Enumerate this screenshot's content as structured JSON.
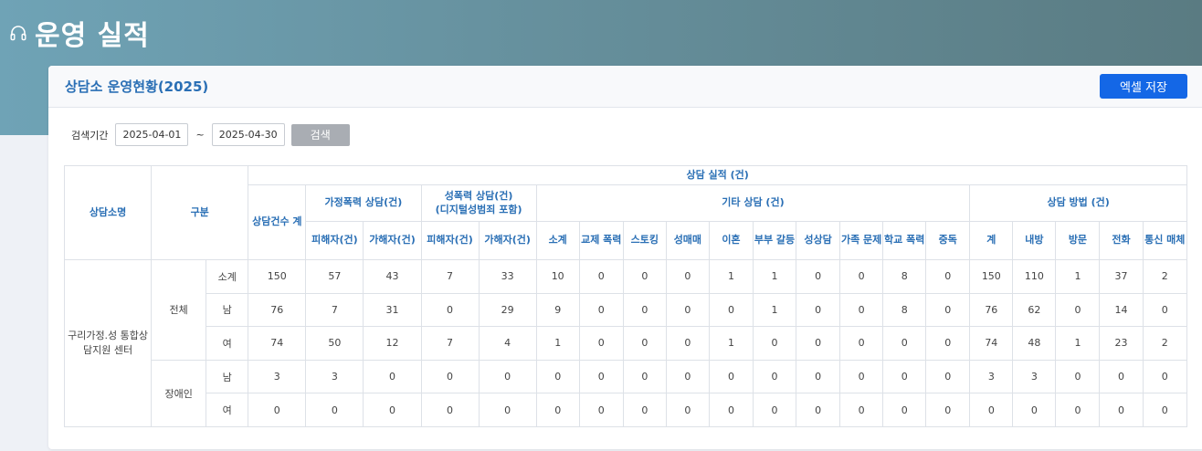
{
  "page": {
    "title": "운영 실적"
  },
  "card": {
    "title": "상담소 운영현황(2025)",
    "excel_button": "엑셀 저장"
  },
  "search": {
    "label": "검색기간",
    "start_date": "2025-04-01",
    "tilde": "~",
    "end_date": "2025-04-30",
    "button": "검색"
  },
  "table": {
    "header": {
      "center": "상담소명",
      "category": "구분",
      "performance": "상담 실적 (건)",
      "total_count": "상담건수 계",
      "domestic": "가정폭력 상담(건)",
      "sexual_line1": "성폭력 상담(건)",
      "sexual_line2": "(디지털성범죄 포함)",
      "other": "기타 상담 (건)",
      "method": "상담 방법 (건)",
      "victim": "피해자(건)",
      "offender": "가해자(건)",
      "subtotal": "소계",
      "dating": "교제 폭력",
      "stalking": "스토킹",
      "prostitution": "성매매",
      "divorce": "이혼",
      "couple": "부부 갈등",
      "sex_counsel": "성상담",
      "family": "가족 문제",
      "school": "학교 폭력",
      "addiction": "중독",
      "m_total": "계",
      "visit_in": "내방",
      "visit_out": "방문",
      "phone": "전화",
      "online": "통신 매체"
    },
    "center_name": "구리가정.성 통합상담지원 센터",
    "groups": [
      "전체",
      "장애인"
    ],
    "rows": [
      {
        "sub": "소계",
        "cells": [
          "150",
          "57",
          "43",
          "7",
          "33",
          "10",
          "0",
          "0",
          "0",
          "1",
          "1",
          "0",
          "0",
          "8",
          "0",
          "150",
          "110",
          "1",
          "37",
          "2"
        ]
      },
      {
        "sub": "남",
        "cells": [
          "76",
          "7",
          "31",
          "0",
          "29",
          "9",
          "0",
          "0",
          "0",
          "0",
          "1",
          "0",
          "0",
          "8",
          "0",
          "76",
          "62",
          "0",
          "14",
          "0"
        ]
      },
      {
        "sub": "여",
        "cells": [
          "74",
          "50",
          "12",
          "7",
          "4",
          "1",
          "0",
          "0",
          "0",
          "1",
          "0",
          "0",
          "0",
          "0",
          "0",
          "74",
          "48",
          "1",
          "23",
          "2"
        ]
      },
      {
        "sub": "남",
        "cells": [
          "3",
          "3",
          "0",
          "0",
          "0",
          "0",
          "0",
          "0",
          "0",
          "0",
          "0",
          "0",
          "0",
          "0",
          "0",
          "3",
          "3",
          "0",
          "0",
          "0"
        ]
      },
      {
        "sub": "여",
        "cells": [
          "0",
          "0",
          "0",
          "0",
          "0",
          "0",
          "0",
          "0",
          "0",
          "0",
          "0",
          "0",
          "0",
          "0",
          "0",
          "0",
          "0",
          "0",
          "0",
          "0"
        ]
      }
    ]
  },
  "icons": {
    "header_icon": "headphones-icon"
  }
}
